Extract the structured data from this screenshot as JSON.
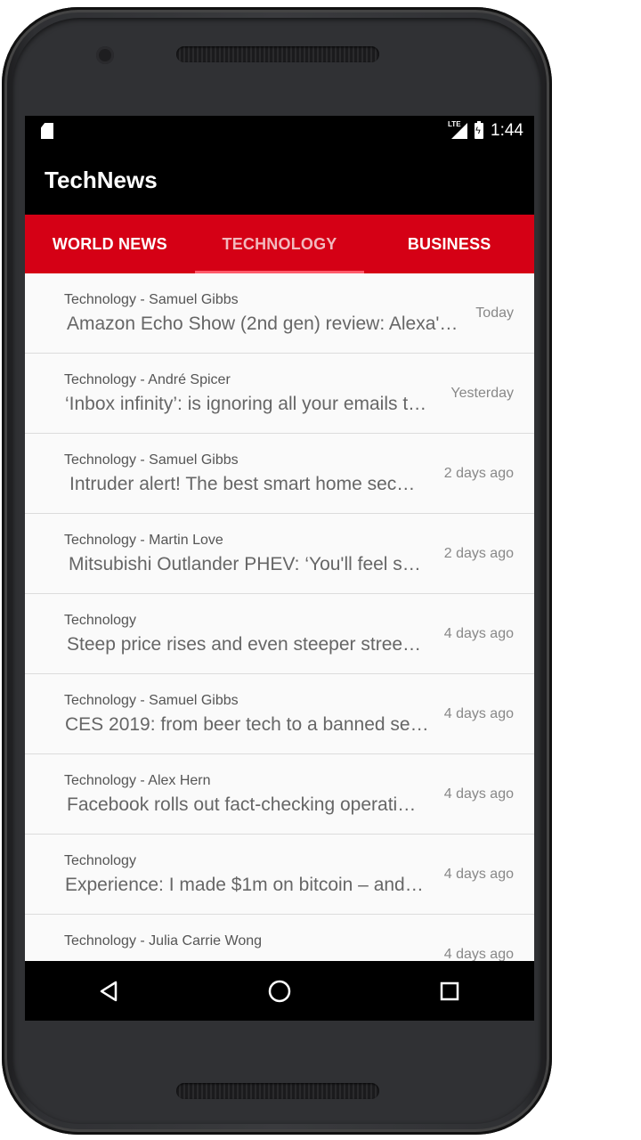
{
  "status_bar": {
    "network_label": "LTE",
    "time": "1:44"
  },
  "app_bar": {
    "title": "TechNews"
  },
  "tabs": [
    {
      "label": "WORLD NEWS",
      "active": false
    },
    {
      "label": "TECHNOLOGY",
      "active": true
    },
    {
      "label": "BUSINESS",
      "active": false
    }
  ],
  "colors": {
    "accent": "#d50015",
    "toolbar": "#000000",
    "list_background": "#fafafa"
  },
  "articles": [
    {
      "section": "Technology - Samuel Gibbs",
      "headline": "Amazon Echo Show (2nd gen) review: Alexa'…",
      "time": "Today"
    },
    {
      "section": "Technology - André Spicer",
      "headline": "‘Inbox infinity’: is ignoring all your emails t…",
      "time": "Yesterday"
    },
    {
      "section": "Technology - Samuel Gibbs",
      "headline": "Intruder alert! The best smart home sec…",
      "time": "2 days ago"
    },
    {
      "section": "Technology - Martin Love",
      "headline": "Mitsubishi Outlander PHEV: ‘You'll feel s…",
      "time": "2 days ago"
    },
    {
      "section": "Technology",
      "headline": "Steep price rises and even steeper stree…",
      "time": "4 days ago"
    },
    {
      "section": "Technology - Samuel Gibbs",
      "headline": "CES 2019: from beer tech to a banned se…",
      "time": "4 days ago"
    },
    {
      "section": "Technology - Alex Hern",
      "headline": "Facebook rolls out fact-checking operati…",
      "time": "4 days ago"
    },
    {
      "section": "Technology",
      "headline": "Experience: I made $1m on bitcoin – and…",
      "time": "4 days ago"
    },
    {
      "section": "Technology - Julia Carrie Wong",
      "headline": "",
      "time": "4 days ago"
    }
  ],
  "nav": {
    "back": "back-icon",
    "home": "home-icon",
    "recents": "recents-icon"
  }
}
